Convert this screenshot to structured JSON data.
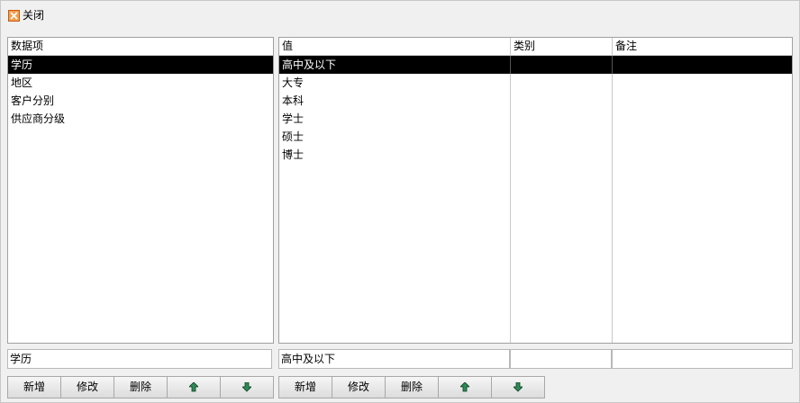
{
  "toolbar": {
    "close_label": "关闭"
  },
  "left_list": {
    "header": "数据项",
    "items": [
      "学历",
      "地区",
      "客户分别",
      "供应商分级"
    ],
    "selected_index": 0
  },
  "right_grid": {
    "columns": [
      "值",
      "类别",
      "备注"
    ],
    "rows": [
      [
        "高中及以下",
        "",
        ""
      ],
      [
        "大专",
        "",
        ""
      ],
      [
        "本科",
        "",
        ""
      ],
      [
        "学士",
        "",
        ""
      ],
      [
        "硕士",
        "",
        ""
      ],
      [
        "博士",
        "",
        ""
      ]
    ],
    "selected_index": 0
  },
  "left_edit": {
    "value": "学历"
  },
  "right_edit": {
    "value": "高中及以下",
    "category": "",
    "note": ""
  },
  "left_buttons": {
    "add": "新增",
    "edit": "修改",
    "delete": "删除",
    "up_icon": "arrow-up-icon",
    "down_icon": "arrow-down-icon"
  },
  "right_buttons": {
    "add": "新增",
    "edit": "修改",
    "delete": "删除",
    "up_icon": "arrow-up-icon",
    "down_icon": "arrow-down-icon"
  },
  "colors": {
    "selection": "#000000",
    "arrow": "#2e8b57",
    "close_icon": "#e8782a"
  }
}
